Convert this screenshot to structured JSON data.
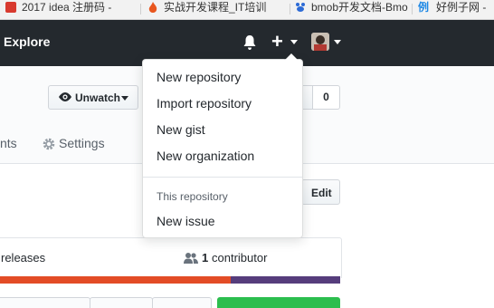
{
  "bookmarks": [
    {
      "label": "2017 idea 注册码 -",
      "icon_color": "#d83a2f"
    },
    {
      "label": "实战开发课程_IT培训",
      "icon_color": "#e8561e"
    },
    {
      "label": "bmob开发文档-Bmo",
      "icon_color": "#2d6bd6"
    },
    {
      "label": "好例子网 -",
      "icon_color": "#1e88e5",
      "icon_text": "例"
    }
  ],
  "header": {
    "explore_label": "Explore",
    "bg_color": "#24292e"
  },
  "repo": {
    "watch_label": "Unwatch",
    "count_value": "0",
    "tab_partial_label": "nts",
    "settings_label": "Settings",
    "edit_label": "Edit",
    "releases_label": "releases",
    "contributor_count": "1",
    "contributor_label": "contributor",
    "lang_colors": [
      "#e34c26",
      "#563d7c"
    ]
  },
  "dropdown": {
    "items": [
      {
        "label": "New repository"
      },
      {
        "label": "Import repository"
      },
      {
        "label": "New gist"
      },
      {
        "label": "New organization"
      }
    ],
    "section_header": "This repository",
    "section_items": [
      {
        "label": "New issue"
      }
    ]
  }
}
